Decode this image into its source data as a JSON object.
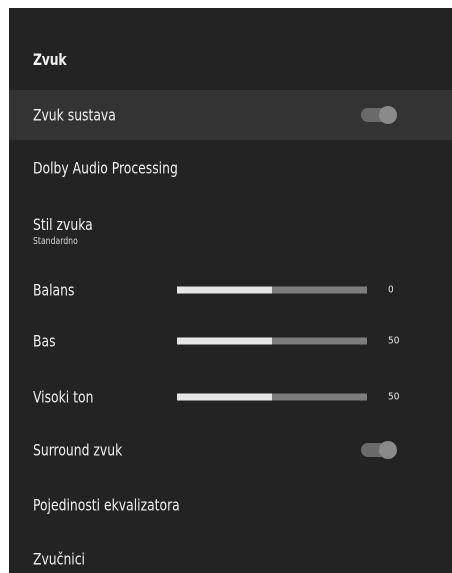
{
  "header": {
    "title": "Zvuk"
  },
  "items": [
    {
      "label": "Zvuk sustava",
      "type": "toggle",
      "on": true,
      "focused": true
    },
    {
      "label": "Dolby Audio Processing",
      "type": "link"
    },
    {
      "label": "Stil zvuka",
      "sublabel": "Standardno",
      "type": "link"
    },
    {
      "label": "Balans",
      "type": "slider",
      "value_text": "0",
      "fill_fraction": 0.5
    },
    {
      "label": "Bas",
      "type": "slider",
      "value_text": "50",
      "fill_fraction": 0.5
    },
    {
      "label": "Visoki ton",
      "type": "slider",
      "value_text": "50",
      "fill_fraction": 0.5
    },
    {
      "label": "Surround zvuk",
      "type": "toggle",
      "on": true
    },
    {
      "label": "Pojedinosti ekvalizatora",
      "type": "link"
    },
    {
      "label": "Zvučnici",
      "type": "link"
    }
  ],
  "colors": {
    "panel_background": "#232323",
    "focused_row": "#333333",
    "text": "#f1f1f1",
    "slider_fill": "#e6e6e6",
    "slider_track": "#7d7d7d",
    "toggle_track": "#6a6a6a",
    "toggle_knob": "#8a8a8a"
  }
}
